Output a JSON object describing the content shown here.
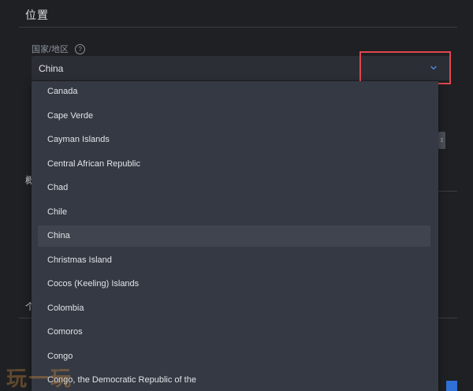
{
  "section": {
    "title": "位置"
  },
  "field": {
    "label": "国家/地区",
    "help_glyph": "?"
  },
  "select": {
    "value": "China",
    "chevron_color": "#4c8fe0"
  },
  "highlight_color": "#e0474f",
  "background": {
    "glyph_left_1": "概",
    "glyph_left_2": "个"
  },
  "dropdown": {
    "options": [
      {
        "label": "Canada",
        "selected": false
      },
      {
        "label": "Cape Verde",
        "selected": false
      },
      {
        "label": "Cayman Islands",
        "selected": false
      },
      {
        "label": "Central African Republic",
        "selected": false
      },
      {
        "label": "Chad",
        "selected": false
      },
      {
        "label": "Chile",
        "selected": false
      },
      {
        "label": "China",
        "selected": true
      },
      {
        "label": "Christmas Island",
        "selected": false
      },
      {
        "label": "Cocos (Keeling) Islands",
        "selected": false
      },
      {
        "label": "Colombia",
        "selected": false
      },
      {
        "label": "Comoros",
        "selected": false
      },
      {
        "label": "Congo",
        "selected": false
      },
      {
        "label": "Congo, the Democratic Republic of the",
        "selected": false
      }
    ]
  },
  "watermark": "玩一玩"
}
